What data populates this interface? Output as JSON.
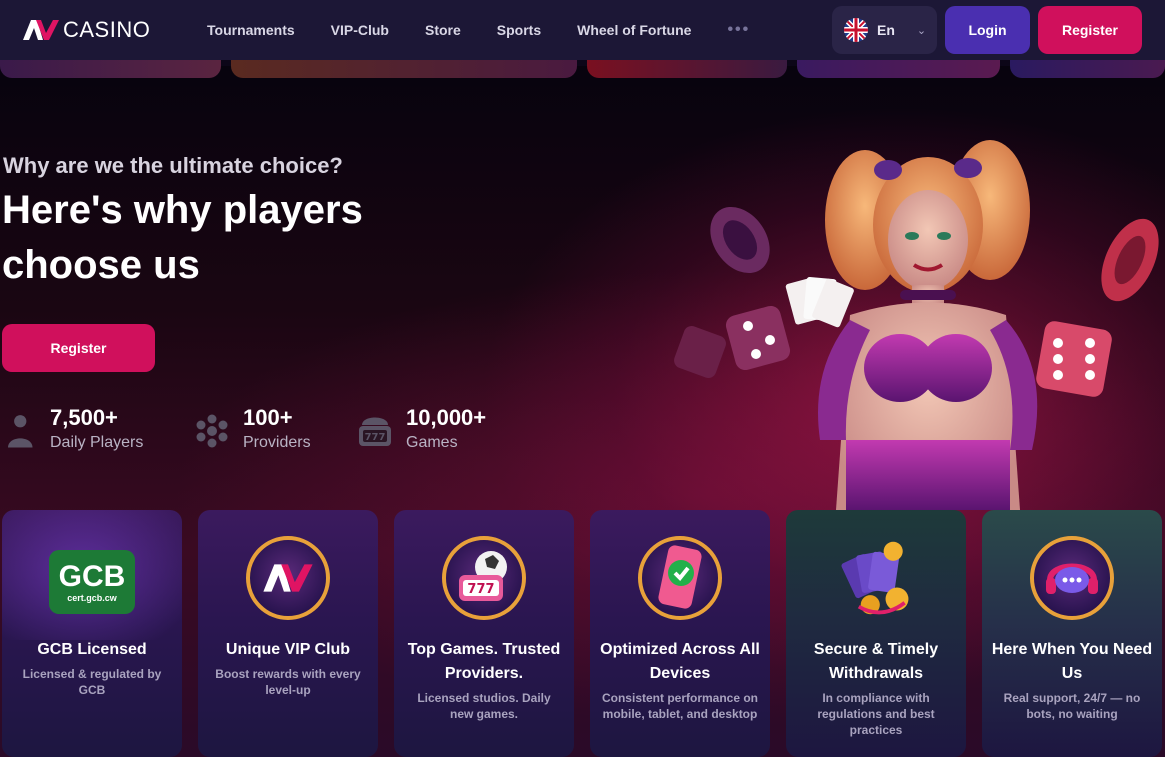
{
  "brand": {
    "logo_text": "CASINO"
  },
  "nav": {
    "items": [
      "Tournaments",
      "VIP-Club",
      "Store",
      "Sports",
      "Wheel of Fortune"
    ],
    "more_label": "•••"
  },
  "language": {
    "label": "En",
    "flag": "uk-flag-icon"
  },
  "header_buttons": {
    "login": "Login",
    "register": "Register"
  },
  "hero": {
    "eyebrow": "Why are we the ultimate choice?",
    "headline": "Here's why players choose us",
    "register": "Register",
    "stats": [
      {
        "value": "7,500+",
        "label": "Daily Players",
        "icon": "user-icon"
      },
      {
        "value": "100+",
        "label": "Providers",
        "icon": "providers-icon"
      },
      {
        "value": "10,000+",
        "label": "Games",
        "icon": "slot-machine-icon"
      }
    ]
  },
  "features": [
    {
      "title": "GCB Licensed",
      "desc": "Licensed & regulated by GCB",
      "icon": "gcb-badge",
      "badge_text": "GCB",
      "badge_sub": "cert.gcb.cw"
    },
    {
      "title": "Unique VIP Club",
      "desc": "Boost rewards with every level-up",
      "icon": "vip-logo-icon"
    },
    {
      "title": "Top Games. Trusted Providers.",
      "desc": "Licensed studios. Daily new games.",
      "icon": "slot-ball-icon"
    },
    {
      "title": "Optimized Across All Devices",
      "desc": "Consistent performance on mobile, tablet, and desktop",
      "icon": "phone-check-icon"
    },
    {
      "title": "Secure & Timely Withdrawals",
      "desc": "In compliance with regulations and best practices",
      "icon": "cards-coins-icon"
    },
    {
      "title": "Here When You Need Us",
      "desc": "Real support, 24/7 — no bots, no waiting",
      "icon": "support-chat-icon"
    }
  ],
  "colors": {
    "accent": "#d0105c",
    "login": "#4a2fb0",
    "header": "#1c1736",
    "badge_ring": "#e8a13a"
  }
}
